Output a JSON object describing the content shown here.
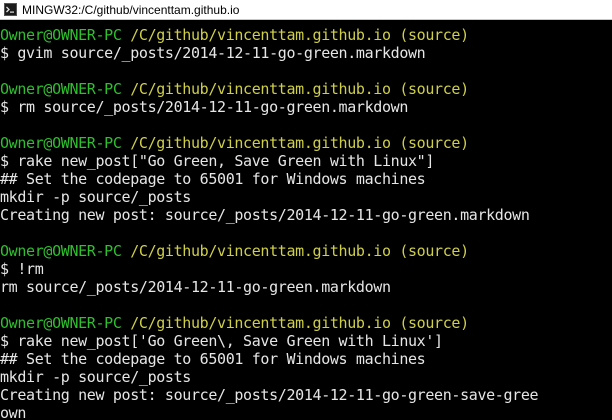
{
  "window": {
    "title": "MINGW32:/C/github/vincenttam.github.io",
    "icon": "mingw-terminal-icon"
  },
  "colors": {
    "background": "#000000",
    "prompt_user": "#2fbf2f",
    "prompt_path": "#cfcf4a",
    "text": "#e6e6e6"
  },
  "terminal": {
    "lines": [
      {
        "user": "Owner@OWNER-PC",
        "path": " /C/github/vincenttam.github.io (source)"
      },
      {
        "text": "$ gvim source/_posts/2014-12-11-go-green.markdown"
      },
      {
        "text": ""
      },
      {
        "user": "Owner@OWNER-PC",
        "path": " /C/github/vincenttam.github.io (source)"
      },
      {
        "text": "$ rm source/_posts/2014-12-11-go-green.markdown"
      },
      {
        "text": ""
      },
      {
        "user": "Owner@OWNER-PC",
        "path": " /C/github/vincenttam.github.io (source)"
      },
      {
        "text": "$ rake new_post[\"Go Green, Save Green with Linux\"]"
      },
      {
        "text": "## Set the codepage to 65001 for Windows machines"
      },
      {
        "text": "mkdir -p source/_posts"
      },
      {
        "text": "Creating new post: source/_posts/2014-12-11-go-green.markdown"
      },
      {
        "text": ""
      },
      {
        "user": "Owner@OWNER-PC",
        "path": " /C/github/vincenttam.github.io (source)"
      },
      {
        "text": "$ !rm"
      },
      {
        "text": "rm source/_posts/2014-12-11-go-green.markdown"
      },
      {
        "text": ""
      },
      {
        "user": "Owner@OWNER-PC",
        "path": " /C/github/vincenttam.github.io (source)"
      },
      {
        "text": "$ rake new_post['Go Green\\, Save Green with Linux']"
      },
      {
        "text": "## Set the codepage to 65001 for Windows machines"
      },
      {
        "text": "mkdir -p source/_posts"
      },
      {
        "text": "Creating new post: source/_posts/2014-12-11-go-green-save-gree"
      },
      {
        "text": "own"
      }
    ]
  }
}
